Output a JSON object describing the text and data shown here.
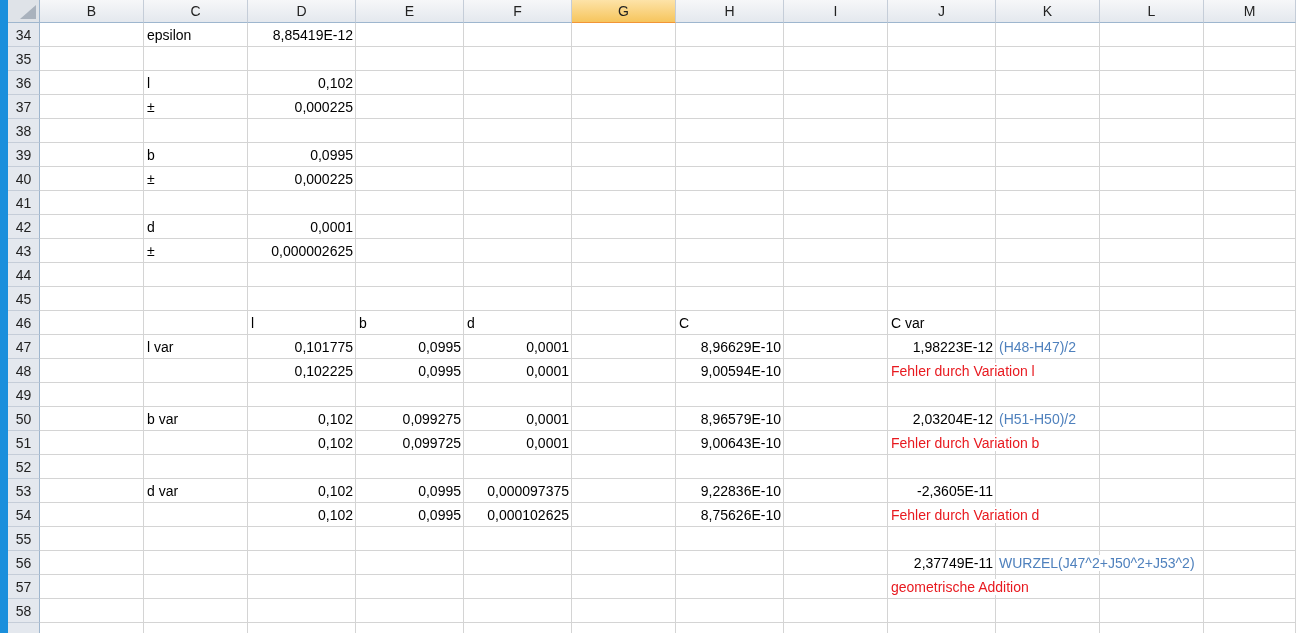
{
  "columns": [
    {
      "label": "B",
      "selected": false
    },
    {
      "label": "C",
      "selected": false
    },
    {
      "label": "D",
      "selected": false
    },
    {
      "label": "E",
      "selected": false
    },
    {
      "label": "F",
      "selected": false
    },
    {
      "label": "G",
      "selected": true
    },
    {
      "label": "H",
      "selected": false
    },
    {
      "label": "I",
      "selected": false
    },
    {
      "label": "J",
      "selected": false
    },
    {
      "label": "K",
      "selected": false
    },
    {
      "label": "L",
      "selected": false
    },
    {
      "label": "M",
      "selected": false
    }
  ],
  "rows": [
    {
      "number": "34",
      "cells": [
        null,
        {
          "text": "epsilon",
          "kind": "label"
        },
        {
          "text": "8,85419E-12",
          "kind": "number"
        }
      ]
    },
    {
      "number": "35",
      "cells": []
    },
    {
      "number": "36",
      "cells": [
        null,
        {
          "text": "l",
          "kind": "label"
        },
        {
          "text": "0,102",
          "kind": "number"
        }
      ]
    },
    {
      "number": "37",
      "cells": [
        null,
        {
          "text": "±",
          "kind": "label"
        },
        {
          "text": "0,000225",
          "kind": "number"
        }
      ]
    },
    {
      "number": "38",
      "cells": []
    },
    {
      "number": "39",
      "cells": [
        null,
        {
          "text": "b",
          "kind": "label"
        },
        {
          "text": "0,0995",
          "kind": "number"
        }
      ]
    },
    {
      "number": "40",
      "cells": [
        null,
        {
          "text": "±",
          "kind": "label"
        },
        {
          "text": "0,000225",
          "kind": "number"
        }
      ]
    },
    {
      "number": "41",
      "cells": []
    },
    {
      "number": "42",
      "cells": [
        null,
        {
          "text": "d",
          "kind": "label"
        },
        {
          "text": "0,0001",
          "kind": "number"
        }
      ]
    },
    {
      "number": "43",
      "cells": [
        null,
        {
          "text": "±",
          "kind": "label"
        },
        {
          "text": "0,000002625",
          "kind": "number"
        }
      ]
    },
    {
      "number": "44",
      "cells": []
    },
    {
      "number": "45",
      "cells": []
    },
    {
      "number": "46",
      "cells": [
        null,
        null,
        {
          "text": "l",
          "kind": "label"
        },
        {
          "text": "b",
          "kind": "label"
        },
        {
          "text": "d",
          "kind": "label"
        },
        null,
        {
          "text": "C",
          "kind": "label"
        },
        null,
        {
          "text": "C var",
          "kind": "label"
        }
      ]
    },
    {
      "number": "47",
      "cells": [
        null,
        {
          "text": "l var",
          "kind": "label"
        },
        {
          "text": "0,101775",
          "kind": "number"
        },
        {
          "text": "0,0995",
          "kind": "number"
        },
        {
          "text": "0,0001",
          "kind": "number"
        },
        null,
        {
          "text": "8,96629E-10",
          "kind": "number"
        },
        null,
        {
          "text": "1,98223E-12",
          "kind": "number"
        },
        {
          "text": "(H48-H47)/2",
          "kind": "formula"
        }
      ]
    },
    {
      "number": "48",
      "cells": [
        null,
        null,
        {
          "text": "0,102225",
          "kind": "number"
        },
        {
          "text": "0,0995",
          "kind": "number"
        },
        {
          "text": "0,0001",
          "kind": "number"
        },
        null,
        {
          "text": "9,00594E-10",
          "kind": "number"
        },
        null,
        {
          "text": "Fehler durch Variation l",
          "kind": "note"
        }
      ]
    },
    {
      "number": "49",
      "cells": []
    },
    {
      "number": "50",
      "cells": [
        null,
        {
          "text": "b var",
          "kind": "label"
        },
        {
          "text": "0,102",
          "kind": "number"
        },
        {
          "text": "0,099275",
          "kind": "number"
        },
        {
          "text": "0,0001",
          "kind": "number"
        },
        null,
        {
          "text": "8,96579E-10",
          "kind": "number"
        },
        null,
        {
          "text": "2,03204E-12",
          "kind": "number"
        },
        {
          "text": "(H51-H50)/2",
          "kind": "formula"
        }
      ]
    },
    {
      "number": "51",
      "cells": [
        null,
        null,
        {
          "text": "0,102",
          "kind": "number"
        },
        {
          "text": "0,099725",
          "kind": "number"
        },
        {
          "text": "0,0001",
          "kind": "number"
        },
        null,
        {
          "text": "9,00643E-10",
          "kind": "number"
        },
        null,
        {
          "text": "Fehler durch Variation b",
          "kind": "note"
        }
      ]
    },
    {
      "number": "52",
      "cells": []
    },
    {
      "number": "53",
      "cells": [
        null,
        {
          "text": "d var",
          "kind": "label"
        },
        {
          "text": "0,102",
          "kind": "number"
        },
        {
          "text": "0,0995",
          "kind": "number"
        },
        {
          "text": "0,000097375",
          "kind": "number"
        },
        null,
        {
          "text": "9,22836E-10",
          "kind": "number"
        },
        null,
        {
          "text": "-2,3605E-11",
          "kind": "number"
        }
      ]
    },
    {
      "number": "54",
      "cells": [
        null,
        null,
        {
          "text": "0,102",
          "kind": "number"
        },
        {
          "text": "0,0995",
          "kind": "number"
        },
        {
          "text": "0,000102625",
          "kind": "number"
        },
        null,
        {
          "text": "8,75626E-10",
          "kind": "number"
        },
        null,
        {
          "text": "Fehler durch Variation d",
          "kind": "note"
        }
      ]
    },
    {
      "number": "55",
      "cells": []
    },
    {
      "number": "56",
      "cells": [
        null,
        null,
        null,
        null,
        null,
        null,
        null,
        null,
        {
          "text": "2,37749E-11",
          "kind": "number"
        },
        {
          "text": "WURZEL(J47^2+J50^2+J53^2)",
          "kind": "formula"
        }
      ]
    },
    {
      "number": "57",
      "cells": [
        null,
        null,
        null,
        null,
        null,
        null,
        null,
        null,
        {
          "text": "geometrische Addition",
          "kind": "note"
        }
      ]
    },
    {
      "number": "58",
      "cells": []
    }
  ]
}
